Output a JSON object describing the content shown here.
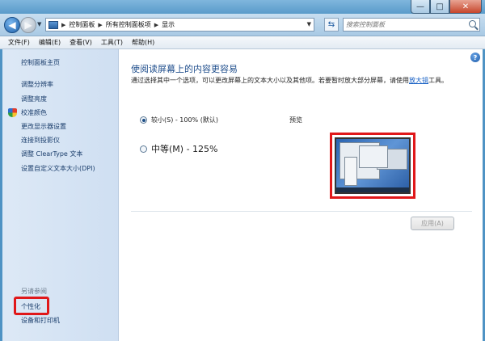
{
  "window": {
    "controls": {
      "minimize": "—",
      "maximize": "□",
      "close": "✕"
    }
  },
  "address": {
    "crumbs": [
      "控制面板",
      "所有控制面板项",
      "显示"
    ],
    "search_placeholder": "搜索控制面板"
  },
  "menu": [
    "文件(F)",
    "编辑(E)",
    "查看(V)",
    "工具(T)",
    "帮助(H)"
  ],
  "sidebar": {
    "home": "控制面板主页",
    "links": [
      "调整分辨率",
      "调整亮度",
      "校准颜色",
      "更改显示器设置",
      "连接到投影仪",
      "调整 ClearType 文本",
      "设置自定义文本大小(DPI)"
    ],
    "see_also_title": "另请参阅",
    "see_also": [
      "个性化",
      "设备和打印机"
    ]
  },
  "main": {
    "title": "使阅读屏幕上的内容更容易",
    "description": "通过选择其中一个选项，可以更改屏幕上的文本大小以及其他项。若要暂时放大部分屏幕，请使用",
    "description_link": "放大镜",
    "description_end": "工具。",
    "options": [
      {
        "label": "较小(S) - 100% (默认)",
        "checked": true
      },
      {
        "label": "中等(M) - 125%",
        "checked": false
      }
    ],
    "preview_label": "预览",
    "apply_button": "应用(A)"
  },
  "colors": {
    "link": "#1a3d6b",
    "title": "#1f4e8c",
    "highlight": "#e0181a"
  }
}
